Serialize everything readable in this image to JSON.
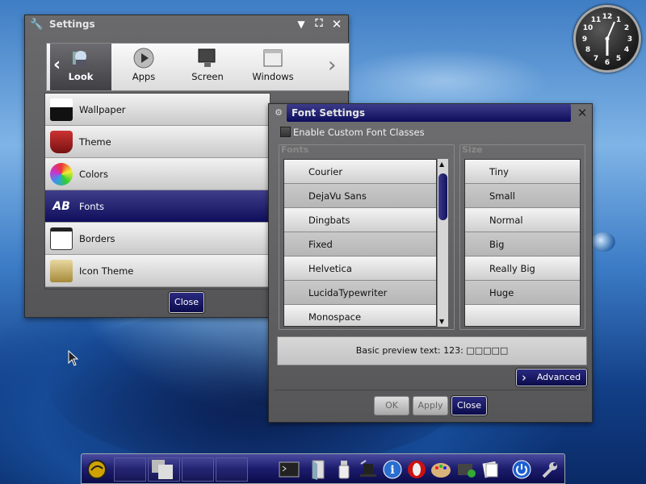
{
  "settings_window": {
    "title": "Settings",
    "categories": [
      "Look",
      "Apps",
      "Screen",
      "Windows"
    ],
    "active_category": "Look",
    "items": [
      "Wallpaper",
      "Theme",
      "Colors",
      "Fonts",
      "Borders",
      "Icon Theme"
    ],
    "selected_item": "Fonts",
    "close_label": "Close"
  },
  "font_dialog": {
    "title": "Font Settings",
    "enable_label": "Enable Custom Font Classes",
    "enable_checked": false,
    "fonts_label": "Fonts",
    "size_label": "Size",
    "fonts": [
      "Courier",
      "DejaVu Sans",
      "Dingbats",
      "Fixed",
      "Helvetica",
      "LucidaTypewriter",
      "Monospace"
    ],
    "sizes": [
      "Tiny",
      "Small",
      "Normal",
      "Big",
      "Really Big",
      "Huge"
    ],
    "preview_text": "Basic preview text: 123: □□□□□",
    "advanced_label": "Advanced",
    "ok_label": "OK",
    "apply_label": "Apply",
    "close_label": "Close"
  },
  "clock": {
    "numbers": [
      "12",
      "1",
      "2",
      "3",
      "4",
      "5",
      "6",
      "7",
      "8",
      "9",
      "10",
      "11"
    ]
  },
  "colors": {
    "accent": "#0d0d5d",
    "window_bg": "#5d5d5f",
    "desktop": "#3c7cc6"
  }
}
